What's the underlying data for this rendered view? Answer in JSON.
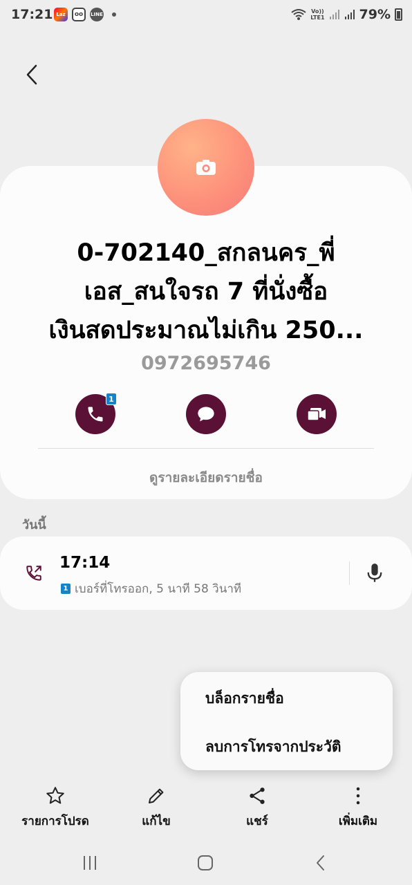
{
  "status_bar": {
    "time": "17:21",
    "volte": "Vo))",
    "lte": "LTE1",
    "battery": "79%",
    "notification_icons": [
      "lazada-icon",
      "voicemail-icon",
      "line-icon"
    ]
  },
  "contact": {
    "name": "0-702140_สกลนคร_พี่เอส_สนใจรถ 7 ที่นั่งซื้อเงินสดประมาณไม่เกิน 250...",
    "name_lines": [
      "0-702140_สกลนคร_พี่",
      "เอส_สนใจรถ 7 ที่นั่งซื้อ",
      "เงินสดประมาณไม่เกิน 250..."
    ],
    "number": "0972695746",
    "call_badge": "1",
    "view_details": "ดูรายละเอียดรายชื่อ"
  },
  "history": {
    "section_label": "วันนี้",
    "items": [
      {
        "time": "17:14",
        "sim": "1",
        "detail": "เบอร์ที่โทรออก, 5 นาที 58 วินาที"
      }
    ]
  },
  "menu": {
    "items": [
      "บล็อกรายชื่อ",
      "ลบการโทรจากประวัติ"
    ]
  },
  "toolbar": {
    "favorites": "รายการโปรด",
    "edit": "แก้ไข",
    "share": "แชร์",
    "more": "เพิ่มเติม"
  },
  "colors": {
    "accent": "#5b1136",
    "avatar_gradient": [
      "#ffb388",
      "#f37b7c"
    ],
    "sim_badge": "#1683c6"
  }
}
